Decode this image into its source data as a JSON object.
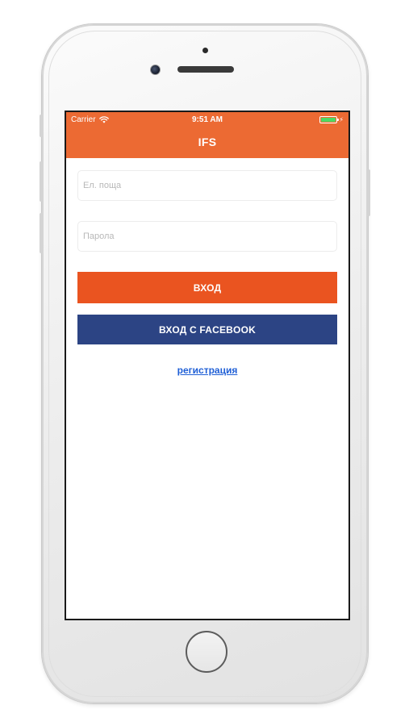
{
  "status_bar": {
    "carrier": "Carrier",
    "time": "9:51 AM",
    "battery_level": 1.0,
    "charging": true
  },
  "nav": {
    "title": "IFS",
    "color": "#ec6a33"
  },
  "form": {
    "email_placeholder": "Ел. поща",
    "email_value": "",
    "password_placeholder": "Парола",
    "password_value": ""
  },
  "buttons": {
    "login_label": "ВХОД",
    "login_color": "#ea5420",
    "facebook_label": "ВХОД С FACEBOOK",
    "facebook_color": "#2c4484"
  },
  "links": {
    "register_label": "регистрация",
    "register_color": "#1f5fd6"
  },
  "icons": {
    "wifi": "wifi-icon",
    "battery": "battery-icon",
    "charging": "charging-bolt-icon"
  }
}
